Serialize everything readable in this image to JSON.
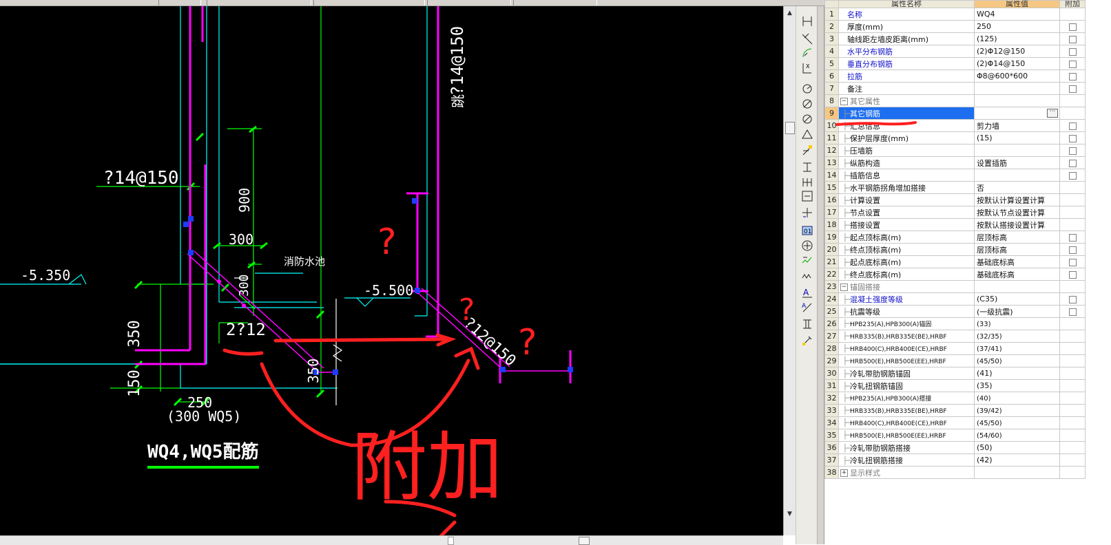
{
  "properties_panel": {
    "headers": {
      "name": "属性名称",
      "value": "属性值",
      "extra": "附加"
    },
    "rows": [
      {
        "num": "1",
        "name": "名称",
        "value": "WQ4",
        "color": "blue",
        "check": false
      },
      {
        "num": "2",
        "name": "厚度(mm)",
        "value": "250",
        "check": true
      },
      {
        "num": "3",
        "name": "轴线距左墙皮距离(mm)",
        "value": "(125)",
        "check": true
      },
      {
        "num": "4",
        "name": "水平分布钢筋",
        "value": "(2)Φ12@150",
        "color": "blue",
        "check": true
      },
      {
        "num": "5",
        "name": "垂直分布钢筋",
        "value": "(2)Φ14@150",
        "color": "blue",
        "check": true
      },
      {
        "num": "6",
        "name": "拉筋",
        "value": "Φ8@600*600",
        "color": "blue",
        "check": true
      },
      {
        "num": "7",
        "name": "备注",
        "value": "",
        "check": true
      },
      {
        "num": "8",
        "name": "其它属性",
        "value": "",
        "group": "minus"
      },
      {
        "num": "9",
        "name": "其它钢筋",
        "value": "",
        "indent": true,
        "selected": true,
        "ellipsis": true
      },
      {
        "num": "10",
        "name": "汇总信息",
        "value": "剪力墙",
        "indent": true,
        "check": true
      },
      {
        "num": "11",
        "name": "保护层厚度(mm)",
        "value": "(15)",
        "indent": true,
        "check": true
      },
      {
        "num": "12",
        "name": "压墙筋",
        "value": "",
        "indent": true,
        "check": true
      },
      {
        "num": "13",
        "name": "纵筋构造",
        "value": "设置插筋",
        "indent": true,
        "check": true
      },
      {
        "num": "14",
        "name": "插筋信息",
        "value": "",
        "indent": true,
        "check": true
      },
      {
        "num": "15",
        "name": "水平钢筋拐角增加搭接",
        "value": "否",
        "indent": true,
        "check": false
      },
      {
        "num": "16",
        "name": "计算设置",
        "value": "按默认计算设置计算",
        "indent": true,
        "check": false
      },
      {
        "num": "17",
        "name": "节点设置",
        "value": "按默认节点设置计算",
        "indent": true,
        "check": false
      },
      {
        "num": "18",
        "name": "搭接设置",
        "value": "按默认搭接设置计算",
        "indent": true,
        "check": false
      },
      {
        "num": "19",
        "name": "起点顶标高(m)",
        "value": "层顶标高",
        "indent": true,
        "check": true
      },
      {
        "num": "20",
        "name": "终点顶标高(m)",
        "value": "层顶标高",
        "indent": true,
        "check": true
      },
      {
        "num": "21",
        "name": "起点底标高(m)",
        "value": "基础底标高",
        "indent": true,
        "check": true
      },
      {
        "num": "22",
        "name": "终点底标高(m)",
        "value": "基础底标高",
        "indent": true,
        "check": true
      },
      {
        "num": "23",
        "name": "锚固搭接",
        "value": "",
        "group": "minus"
      },
      {
        "num": "24",
        "name": "混凝土强度等级",
        "value": "(C35)",
        "indent": true,
        "color": "blue",
        "check": true
      },
      {
        "num": "25",
        "name": "抗震等级",
        "value": "(一级抗震)",
        "indent": true,
        "check": true
      },
      {
        "num": "26",
        "name": "HPB235(A),HPB300(A)锚固",
        "value": "(33)",
        "indent": true,
        "small": true
      },
      {
        "num": "27",
        "name": "HRB335(B),HRB335E(BE),HRBF",
        "value": "(32/35)",
        "indent": true,
        "small": true
      },
      {
        "num": "28",
        "name": "HRB400(C),HRB400E(CE),HRBF",
        "value": "(37/41)",
        "indent": true,
        "small": true
      },
      {
        "num": "29",
        "name": "HRB500(E),HRB500E(EE),HRBF",
        "value": "(45/50)",
        "indent": true,
        "small": true
      },
      {
        "num": "30",
        "name": "冷轧带肋钢筋锚固",
        "value": "(41)",
        "indent": true
      },
      {
        "num": "31",
        "name": "冷轧扭钢筋锚固",
        "value": "(35)",
        "indent": true
      },
      {
        "num": "32",
        "name": "HPB235(A),HPB300(A)搭接",
        "value": "(40)",
        "indent": true,
        "small": true
      },
      {
        "num": "33",
        "name": "HRB335(B),HRB335E(BE),HRBF",
        "value": "(39/42)",
        "indent": true,
        "small": true
      },
      {
        "num": "34",
        "name": "HRB400(C),HRB400E(CE),HRBF",
        "value": "(45/50)",
        "indent": true,
        "small": true
      },
      {
        "num": "35",
        "name": "HRB500(E),HRB500E(EE),HRBF",
        "value": "(54/60)",
        "indent": true,
        "small": true
      },
      {
        "num": "36",
        "name": "冷轧带肋钢筋搭接",
        "value": "(50)",
        "indent": true
      },
      {
        "num": "37",
        "name": "冷轧扭钢筋搭接",
        "value": "(42)",
        "indent": true
      },
      {
        "num": "38",
        "name": "显示样式",
        "value": "",
        "group": "plus"
      }
    ]
  },
  "drawing": {
    "labels": {
      "rebar_14_150": "?14@150",
      "elev_5350": "-5.350",
      "dim_350": "350",
      "dim_150": "150",
      "dim_250": "250",
      "dim_300_wq5": "(300 WQ5)",
      "title": "WQ4,WQ5配筋",
      "dim_900": "900",
      "dim_300": "300",
      "dim_300b": "300",
      "pool": "消防水池",
      "rebar_2_12": "2?12",
      "dim_350b": "350",
      "elev_5500": "-5.500",
      "rebar_12_150": "?12@150",
      "rebar_mid": "?14@15C",
      "side_text": "跳",
      "bottom_text": "?14@150"
    },
    "annotations": {
      "question": "?",
      "fujia": "附加"
    },
    "colors": {
      "background": "#000000",
      "magenta": "#ff00ff",
      "cyan": "#00ffff",
      "green": "#00ff00",
      "white": "#ffffff",
      "red_annotation": "#ff2020",
      "grip_blue": "#1e3cff"
    }
  },
  "toolbar_icons": [
    "dim-linear-icon",
    "dim-aligned-icon",
    "dim-arc-icon",
    "dim-ordinate-icon",
    "dim-radius-icon",
    "dim-diameter-icon",
    "dim-angle-icon",
    "dim-arclen-icon",
    "dim-quick-icon",
    "dim-baseline-icon",
    "dim-continue-icon",
    "leader-icon",
    "tolerance-icon",
    "center-mark-icon",
    "dim-edit-icon",
    "dim-text-edit-icon",
    "dim-update-icon",
    "dim-style-icon",
    "dim-override-icon",
    "dim-reassoc-icon"
  ]
}
